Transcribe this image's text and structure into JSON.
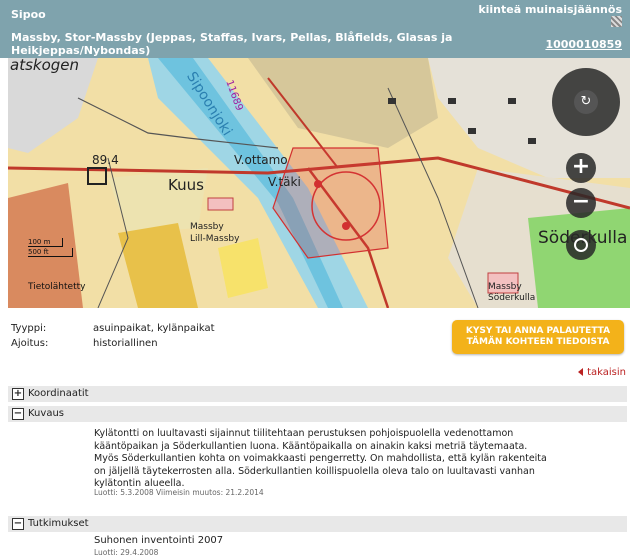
{
  "header": {
    "municipality": "Sipoo",
    "object_type": "kiinteä muinaisjäännös",
    "title": "Massby, Stor-Massby (Jeppas, Staffas, Ivars, Pellas, Blåfields, Glasas ja Heikjeppas/Nybondas)",
    "id_link": "1000010859"
  },
  "map": {
    "labels": {
      "forest": "atskogen",
      "river": "Sipoonjoki",
      "road_number": "11689",
      "elevation": "89.4",
      "kuus": "Kuus",
      "vottamo": "V.ottamo",
      "vtaki": "V.täki",
      "lill_massby_1": "Massby",
      "lill_massby_2": "Lill-Massby",
      "soderkulla": "Söderkulla",
      "soder_massby_1": "Massby",
      "soder_massby_2": "Söderkulla",
      "scale_m": "100 m",
      "scale_ft": "500 ft",
      "logo": "Tietolähtetty"
    },
    "controls": {
      "rotate_icon": "rotate-icon",
      "zoom_in": "+",
      "zoom_out": "−"
    }
  },
  "meta": {
    "type_label": "Tyyppi:",
    "type_value": "asuinpaikat, kylänpaikat",
    "dating_label": "Ajoitus:",
    "dating_value": "historiallinen"
  },
  "feedback_button": "KYSY TAI ANNA PALAUTETTA TÄMÄN KOHTEEN TIEDOISTA",
  "back_link": "takaisin",
  "sections": {
    "coords": {
      "toggle": "+",
      "label": "Koordinaatit"
    },
    "description": {
      "toggle": "−",
      "label": "Kuvaus"
    },
    "research": {
      "toggle": "−",
      "label": "Tutkimukset"
    }
  },
  "description_text": "Kylätontti on luultavasti sijainnut tiilitehtaan perustuksen pohjoispuolella vedenottamon kääntöpaikan ja Söderkullantien luona. Kääntöpaikalla on ainakin kaksi metriä täytemaata. Myös Söderkullantien kohta on voimakkaasti pengerretty. On mahdollista, että kylän rakenteita on jäljellä täytekerrosten alla. Söderkullantien koillispuolella oleva talo on luultavasti vanhan kylätontin alueella.",
  "description_dates": "Luotti: 5.3.2008 Viimeisin muutos: 21.2.2014",
  "research_item": "Suhonen inventointi 2007",
  "research_date": "Luotti: 29.4.2008"
}
